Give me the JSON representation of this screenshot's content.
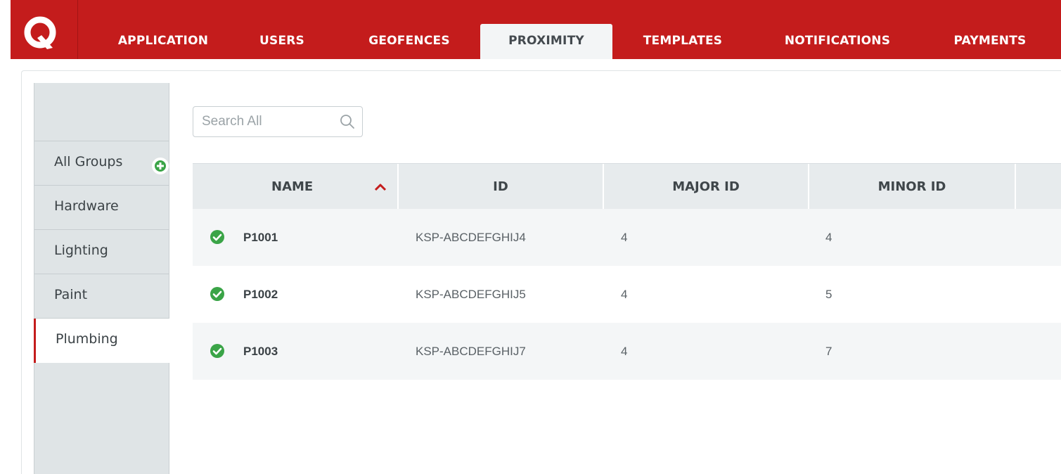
{
  "nav": {
    "tabs": [
      {
        "label": "APPLICATION",
        "active": false
      },
      {
        "label": "USERS",
        "active": false
      },
      {
        "label": "GEOFENCES",
        "active": false
      },
      {
        "label": "PROXIMITY",
        "active": true
      },
      {
        "label": "TEMPLATES",
        "active": false
      },
      {
        "label": "NOTIFICATIONS",
        "active": false
      },
      {
        "label": "PAYMENTS",
        "active": false
      }
    ]
  },
  "sidebar": {
    "items": [
      {
        "label": "All Groups",
        "active": false
      },
      {
        "label": "Hardware",
        "active": false
      },
      {
        "label": "Lighting",
        "active": false
      },
      {
        "label": "Paint",
        "active": false
      },
      {
        "label": "Plumbing",
        "active": true
      }
    ]
  },
  "search": {
    "placeholder": "Search All",
    "value": ""
  },
  "table": {
    "columns": [
      "NAME",
      "ID",
      "MAJOR ID",
      "MINOR ID"
    ],
    "sort": {
      "column": "NAME",
      "direction": "ascending"
    },
    "rows": [
      {
        "name": "P1001",
        "id": "KSP-ABCDEFGHIJ4",
        "major": "4",
        "minor": "4",
        "status": "active"
      },
      {
        "name": "P1002",
        "id": "KSP-ABCDEFGHIJ5",
        "major": "4",
        "minor": "5",
        "status": "active"
      },
      {
        "name": "P1003",
        "id": "KSP-ABCDEFGHIJ7",
        "major": "4",
        "minor": "7",
        "status": "active"
      }
    ]
  },
  "colors": {
    "brand": "#c41c1c",
    "status_ok": "#3aa447",
    "sort_arrow": "#c41c1c"
  }
}
